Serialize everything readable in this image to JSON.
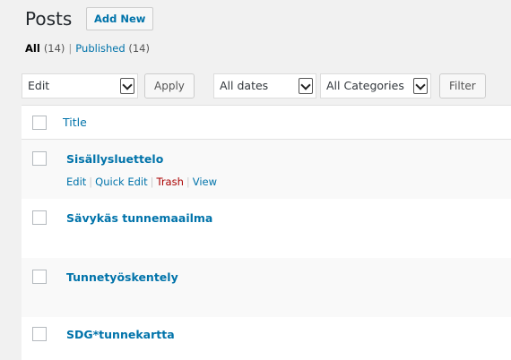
{
  "header": {
    "title": "Posts",
    "add_new_label": "Add New"
  },
  "views": {
    "all_label": "All",
    "all_count": "(14)",
    "separator": "|",
    "published_label": "Published",
    "published_count": "(14)"
  },
  "toolbar": {
    "bulk_action_value": "Edit",
    "apply_label": "Apply",
    "dates_value": "All dates",
    "categories_value": "All Categories",
    "filter_label": "Filter"
  },
  "table": {
    "title_column": "Title",
    "rows": [
      {
        "title": "Sisällysluettelo"
      },
      {
        "title": "Sävykäs tunnemaailma"
      },
      {
        "title": "Tunnetyöskentely"
      },
      {
        "title": "SDG*tunnekartta"
      }
    ],
    "row_actions": {
      "edit": "Edit",
      "quick_edit": "Quick Edit",
      "trash": "Trash",
      "view": "View",
      "separator": "|"
    }
  },
  "colors": {
    "link": "#0073aa",
    "trash": "#aa0000",
    "background": "#f1f1f1"
  }
}
